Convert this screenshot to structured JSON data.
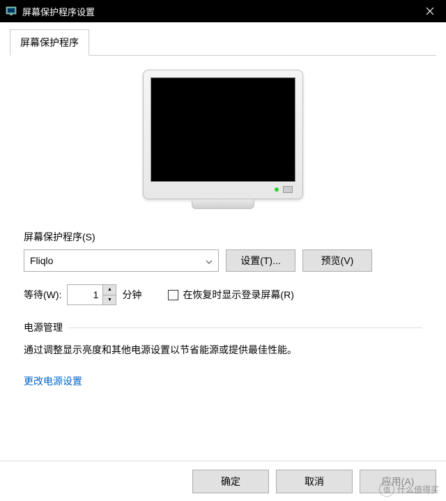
{
  "titlebar": {
    "title": "屏幕保护程序设置"
  },
  "tab": {
    "label": "屏幕保护程序"
  },
  "screensaver": {
    "section_label": "屏幕保护程序(S)",
    "selected": "Fliqlo",
    "settings_btn": "设置(T)...",
    "preview_btn": "预览(V)"
  },
  "wait": {
    "label": "等待(W):",
    "value": "1",
    "unit": "分钟",
    "checkbox_label": "在恢复时显示登录屏幕(R)"
  },
  "power": {
    "section_label": "电源管理",
    "description": "通过调整显示亮度和其他电源设置以节省能源或提供最佳性能。",
    "link": "更改电源设置"
  },
  "footer": {
    "ok": "确定",
    "cancel": "取消",
    "apply": "应用(A)"
  },
  "watermark": {
    "icon_text": "值",
    "text": "什么值得买"
  }
}
